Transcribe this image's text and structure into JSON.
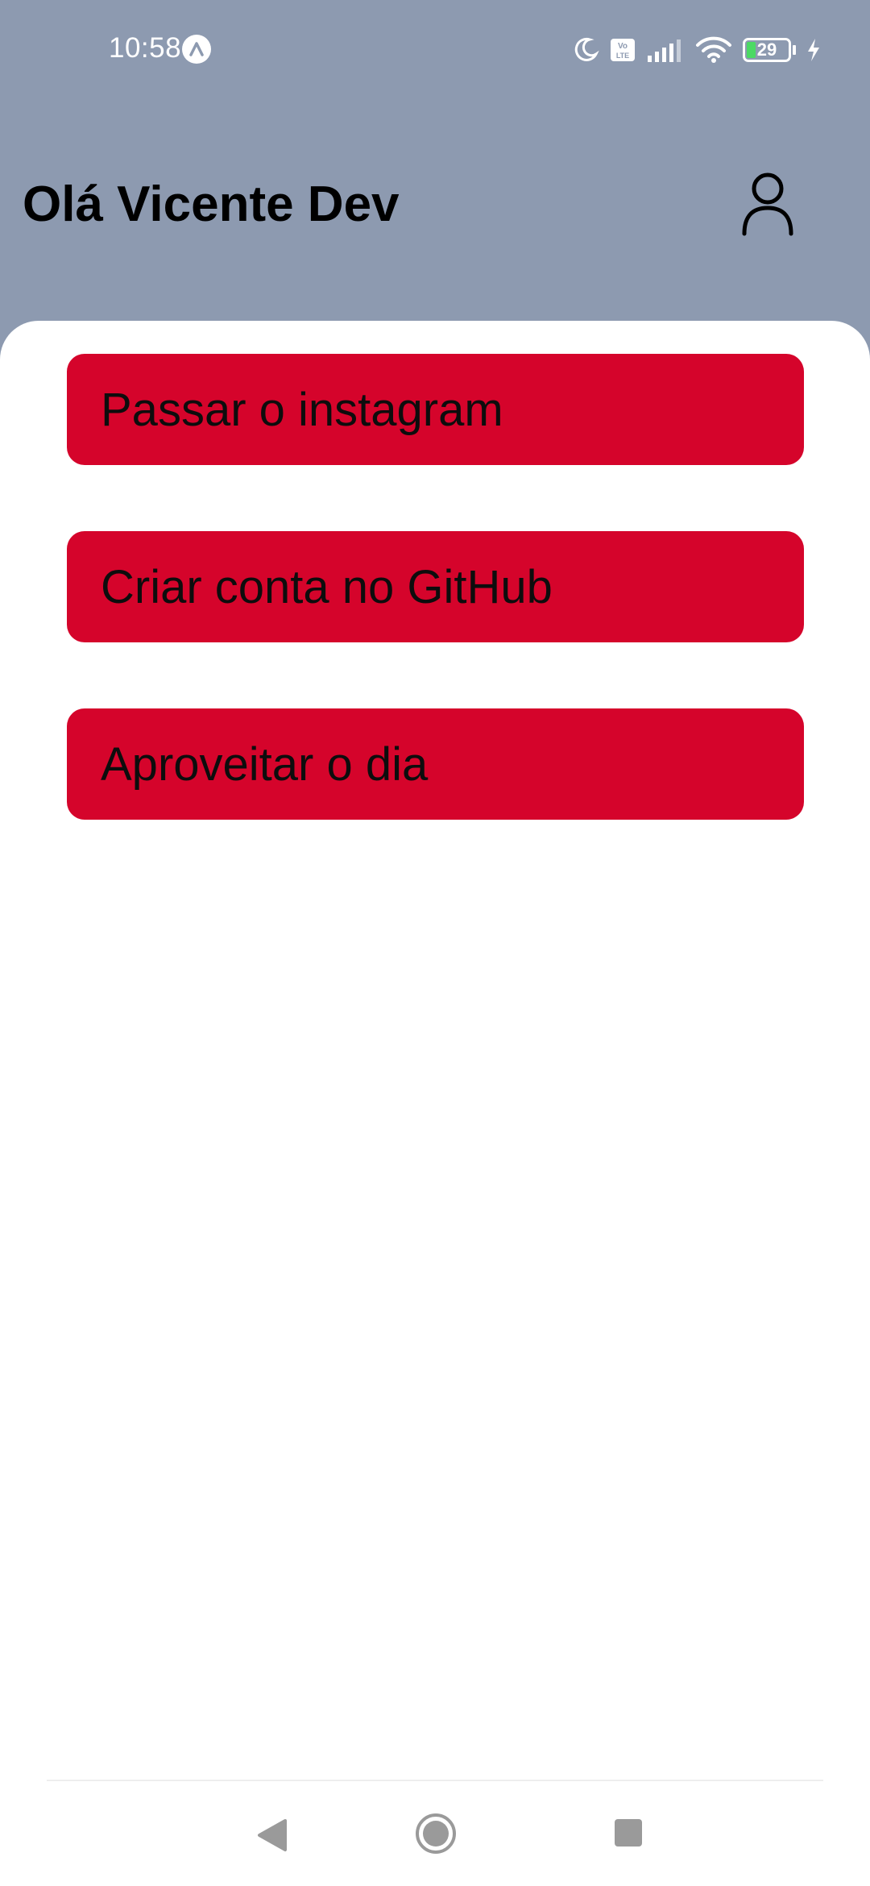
{
  "status_bar": {
    "time": "10:58",
    "app_icon": "expo-icon",
    "indicators": [
      "moon-icon",
      "volte-icon",
      "signal-icon",
      "wifi-icon"
    ],
    "battery_level": "29",
    "charging_icon": "bolt-icon"
  },
  "header": {
    "greeting": "Olá Vicente Dev",
    "profile_icon": "user-icon",
    "background_color": "#8d9ab0"
  },
  "tasks": {
    "accent_color": "#d5042b",
    "items": [
      {
        "label": "Passar o instagram"
      },
      {
        "label": "Criar conta no GitHub"
      },
      {
        "label": "Aproveitar o dia"
      }
    ]
  },
  "nav_bar": {
    "back": "back-triangle-icon",
    "home": "home-circle-icon",
    "recents": "recents-square-icon"
  }
}
